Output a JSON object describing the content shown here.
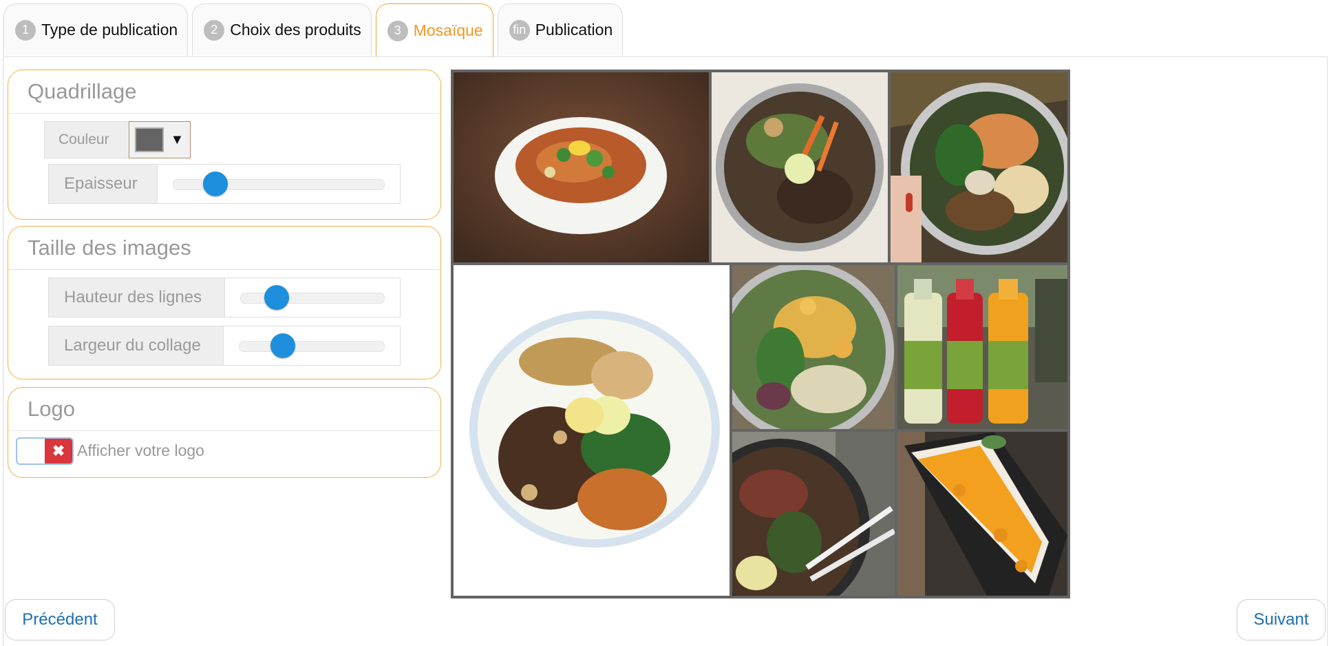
{
  "tabs": [
    {
      "num": "1",
      "label": "Type de publication"
    },
    {
      "num": "2",
      "label": "Choix des produits"
    },
    {
      "num": "3",
      "label": "Mosaïque"
    },
    {
      "num": "fin",
      "label": "Publication"
    }
  ],
  "active_tab": "Mosaïque",
  "grid": {
    "title": "Quadrillage",
    "color_label": "Couleur",
    "color_value": "#646464",
    "thickness_label": "Epaisseur",
    "thickness_level": 0.2
  },
  "image_size": {
    "title": "Taille des images",
    "row_height_label": "Hauteur des lignes",
    "row_height_level": 0.25,
    "collage_width_label": "Largeur du collage",
    "collage_width_level": 0.3
  },
  "logo": {
    "title": "Logo",
    "toggle_state": "off",
    "toggle_label": "Afficher votre logo"
  },
  "mosaic": {
    "images": [
      "pad-thai-bowl",
      "bo-bun-bowl-top",
      "shrimp-noodle-bowl",
      "bo-bun-plate-large",
      "tofu-salad-bowl",
      "juice-bottles",
      "beef-salad-bowl",
      "mango-cheesecake"
    ]
  },
  "nav": {
    "prev_label": "Précédent",
    "next_label": "Suivant"
  },
  "colors": {
    "accent": "#f39624",
    "link": "#1c6fb3",
    "slider": "#1d8fdc",
    "toggle_off": "#d9363e"
  }
}
